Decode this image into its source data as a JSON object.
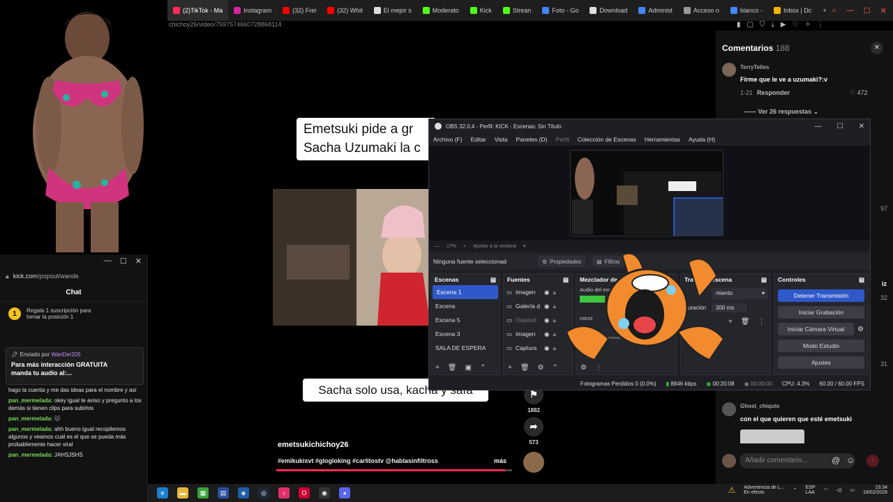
{
  "browser": {
    "tabs": [
      {
        "label": "(2)TikTok - Ma",
        "color": "#fe2c55",
        "active": true
      },
      {
        "label": "Instagram",
        "color": "#d6249f"
      },
      {
        "label": "(32) Frei",
        "color": "#ff0000"
      },
      {
        "label": "(32) Whit",
        "color": "#ff0000"
      },
      {
        "label": "El mejor s",
        "color": "#dddddd"
      },
      {
        "label": "Moderato",
        "color": "#53fc18"
      },
      {
        "label": "Kick",
        "color": "#53fc18"
      },
      {
        "label": "Strean",
        "color": "#53fc18"
      },
      {
        "label": "Foto - Go",
        "color": "#4285f4"
      },
      {
        "label": "Download",
        "color": "#dddddd"
      },
      {
        "label": "Administ",
        "color": "#4285f4"
      },
      {
        "label": "Acceso n",
        "color": "#999999"
      },
      {
        "label": "blanco - ",
        "color": "#4285f4"
      },
      {
        "label": "Inbox | Dc",
        "color": "#f4b400"
      }
    ],
    "url": "chichoy26/video/7597574660728868114"
  },
  "kick_popout": {
    "url_domain": "kick.com",
    "url_path": "/popout/wande",
    "chat_title": "Chat",
    "gift_line1": "Regala 1 suscripción para",
    "gift_line2": "tomar la posición 1",
    "pinned_by_label": "Enviado por",
    "pinned_by_user": "WanDer205",
    "pinned_msg_line1": "Para más interacción GRATUITA",
    "pinned_msg_line2": "manda tu audio al:...",
    "chat": [
      {
        "user": "",
        "text": "hago la cuenta y me das ideas para el nombre y así"
      },
      {
        "user": "pan_mermelada:",
        "text": "okey igual te aviso y pregunto a los demás si tienen clips para subirlos"
      },
      {
        "user": "pan_mermelada:",
        "text": ""
      },
      {
        "user": "pan_mermelada:",
        "text": "ahh bueno igual recopilemos algunos y veamos cuál es el que se pueda más probablemente hacer viral"
      },
      {
        "user": "pan_mermelada:",
        "text": "JAHSJSHS"
      }
    ]
  },
  "video": {
    "caption_top_line1": "Emetsuki pide a gr",
    "caption_top_line2": "Sacha Uzumaki la c",
    "caption_bottom": "Sacha solo usa, kacha y safa",
    "author": "emetsukichichoy26",
    "tags": "#emikukisvt #glogloking #carlitostv @hablasinfiltross",
    "more": "más",
    "bookmarks": "1882",
    "shares": "573",
    "progress": 0.97
  },
  "comments": {
    "title": "Comentarios",
    "count": "188",
    "first_user": "TerryTelles",
    "first_text": "Firme que le ve a uzumaki?:v",
    "first_date": "1-21",
    "reply_label": "Responder",
    "first_likes": "472",
    "replies_label": "Ver 26 respuestas",
    "second_user": "Ghost_chiquto",
    "second_text": "con el que quieren que esté emetsuki",
    "add_placeholder": "Añadir comentario...",
    "partial_nums": [
      "97",
      "32",
      "31"
    ],
    "partial_text": "iz"
  },
  "obs": {
    "title": "OBS 32.0.4 - Perfil: KICK - Escenas: Sin Título",
    "menu": [
      "Archivo (F)",
      "Editar",
      "Vista",
      "Paneles (D)",
      "Perfil",
      "Colección de Escenas",
      "Herramientas",
      "Ayuda (H)"
    ],
    "zoom": "17%",
    "fit_label": "Ajustar a la ventana",
    "no_source": "Ninguna fuente seleccionad",
    "properties_label": "Propiedades",
    "filters_label": "Filtros",
    "scenes_title": "Escenas",
    "scenes": [
      "Escena 1",
      "Escena",
      "Escena 5",
      "Escena 3",
      "SALA DE ESPERA"
    ],
    "sources_title": "Fuentes",
    "sources": [
      {
        "name": "Imagen",
        "dim": false
      },
      {
        "name": "Galería d",
        "dim": false
      },
      {
        "name": "Disposit",
        "dim": true
      },
      {
        "name": "Imagen",
        "dim": false
      },
      {
        "name": "Captura",
        "dim": false
      }
    ],
    "mixer_title": "Mezclador de a",
    "mixer_track1": "Audio del escri",
    "mixer_track2": "micro",
    "transitions_title": "Tra   es de escena",
    "transition_value": "miento",
    "duration_label": "Duración",
    "duration_value": "300 ms",
    "controls_title": "Controles",
    "controls": [
      "Detener Transmisión",
      "Iniciar Grabación",
      "Iniciar Cámara Virtual",
      "Modo Estudio",
      "Ajustes"
    ],
    "status": {
      "dropped": "Fotogramas Perdidos 0 (0.0%)",
      "bitrate": "8846 kbps",
      "stream_time": "00:20:08",
      "rec_time": "00:00:00",
      "cpu": "CPU: 4.3%",
      "fps": "60.00 / 60.00 FPS"
    }
  },
  "taskbar": {
    "warning_line1": "Advertencia de L...",
    "warning_line2": "En efecto",
    "lang": "ESP",
    "lang2": "LAA",
    "time": "23:34",
    "date": "18/02/2026"
  }
}
